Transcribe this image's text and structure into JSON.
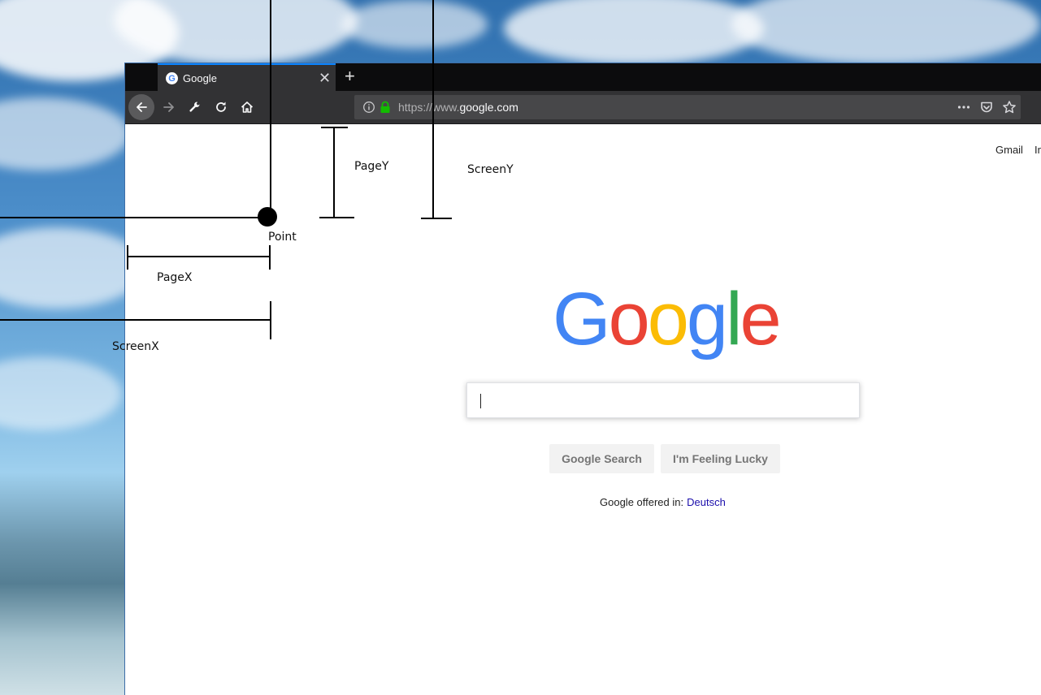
{
  "browser": {
    "tab": {
      "title": "Google",
      "favicon_icon": "google-g-icon"
    },
    "toolbar": {
      "back_icon": "arrow-left-icon",
      "forward_icon": "arrow-right-icon",
      "tools_icon": "wrench-icon",
      "reload_icon": "reload-icon",
      "home_icon": "home-icon"
    },
    "urlbar": {
      "scheme": "https://",
      "subdomain": "www.",
      "domain": "google.com",
      "page_actions_icon": "more-horizontal-icon",
      "pocket_icon": "pocket-icon",
      "bookmark_icon": "star-icon"
    }
  },
  "page": {
    "header": {
      "gmail": "Gmail",
      "images": "Images"
    },
    "logo": {
      "letters": [
        {
          "char": "G",
          "color": "#4285f4"
        },
        {
          "char": "o",
          "color": "#ea4335"
        },
        {
          "char": "o",
          "color": "#fbbc05"
        },
        {
          "char": "g",
          "color": "#4285f4"
        },
        {
          "char": "l",
          "color": "#34a853"
        },
        {
          "char": "e",
          "color": "#ea4335"
        }
      ]
    },
    "search": {
      "value": ""
    },
    "buttons": {
      "search": "Google Search",
      "lucky": "I'm Feeling Lucky"
    },
    "language": {
      "prefix": "Google offered in:",
      "link": "Deutsch"
    }
  },
  "annotations": {
    "point": "Point",
    "page_x": "PageX",
    "page_y": "PageY",
    "screen_x": "ScreenX",
    "screen_y": "ScreenY"
  },
  "colors": {
    "tab_bar": "#0c0c0d",
    "toolbar": "#323234",
    "urlbar": "#474749",
    "lock_green": "#12bc00",
    "link": "#1a0dab"
  }
}
